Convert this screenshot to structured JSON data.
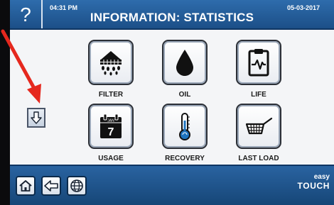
{
  "header": {
    "help_symbol": "?",
    "time": "04:31 PM",
    "title": "INFORMATION: STATISTICS",
    "date": "05-03-2017"
  },
  "menu": {
    "tiles": [
      {
        "label": "FILTER",
        "icon": "filter-icon"
      },
      {
        "label": "OIL",
        "icon": "oil-drop-icon"
      },
      {
        "label": "LIFE",
        "icon": "life-clipboard-icon"
      },
      {
        "label": "USAGE",
        "icon": "calendar-icon",
        "calendar_month": "JAN",
        "calendar_day": "7"
      },
      {
        "label": "RECOVERY",
        "icon": "thermometer-icon"
      },
      {
        "label": "LAST LOAD",
        "icon": "fryer-basket-icon"
      }
    ],
    "scroll_icon": "down-arrow-icon"
  },
  "footer": {
    "buttons": [
      {
        "name": "home-button",
        "icon": "home-icon"
      },
      {
        "name": "back-button",
        "icon": "back-arrow-icon"
      },
      {
        "name": "language-button",
        "icon": "globe-icon"
      }
    ],
    "brand_top": "easy",
    "brand_bottom": "TOUCH"
  },
  "colors": {
    "header_blue": "#1b4e86",
    "footer_blue": "#164677",
    "annotation_red": "#e5281e"
  }
}
